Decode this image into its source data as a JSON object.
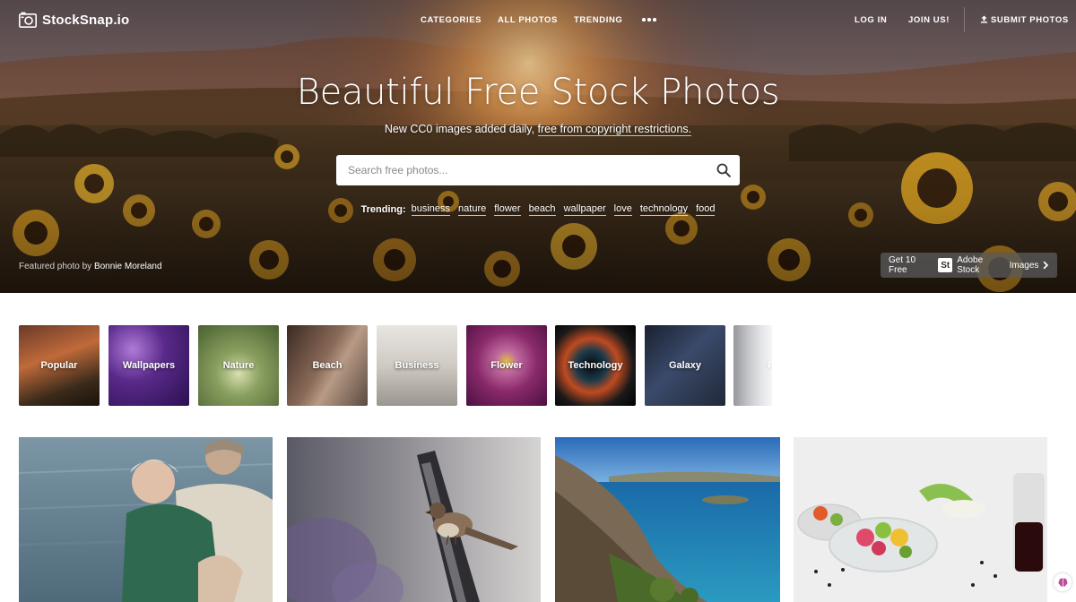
{
  "brand": {
    "name": "StockSnap.io"
  },
  "nav": {
    "left": [
      {
        "label": "CATEGORIES"
      },
      {
        "label": "ALL PHOTOS"
      },
      {
        "label": "TRENDING"
      }
    ],
    "more_icon": "ellipsis-icon",
    "right": [
      {
        "label": "LOG IN"
      },
      {
        "label": "JOIN US!"
      }
    ],
    "submit": {
      "label": "SUBMIT PHOTOS",
      "icon": "upload-icon"
    }
  },
  "hero": {
    "title": "Beautiful Free Stock Photos",
    "subtitle_prefix": "New CC0 images added daily, ",
    "subtitle_link": "free from copyright restrictions.",
    "search": {
      "placeholder": "Search free photos...",
      "value": "",
      "icon": "search-icon"
    },
    "trending_label": "Trending:",
    "trending": [
      "business",
      "nature",
      "flower",
      "beach",
      "wallpaper",
      "love",
      "technology",
      "food"
    ],
    "featured_prefix": "Featured photo by",
    "featured_author": "Bonnie Moreland",
    "adobe": {
      "prefix": "Get 10 Free",
      "badge": "St",
      "suffix": "Adobe Stock",
      "suffix2": "Images",
      "icon": "chevron-right-icon"
    }
  },
  "categories": [
    {
      "label": "Popular"
    },
    {
      "label": "Wallpapers"
    },
    {
      "label": "Nature"
    },
    {
      "label": "Beach"
    },
    {
      "label": "Business"
    },
    {
      "label": "Flower"
    },
    {
      "label": "Technology"
    },
    {
      "label": "Galaxy"
    },
    {
      "label": "Pe"
    }
  ],
  "colors": {
    "hero_text": "#ffffff",
    "search_bg": "#ffffff",
    "page_bg": "#ffffff"
  }
}
